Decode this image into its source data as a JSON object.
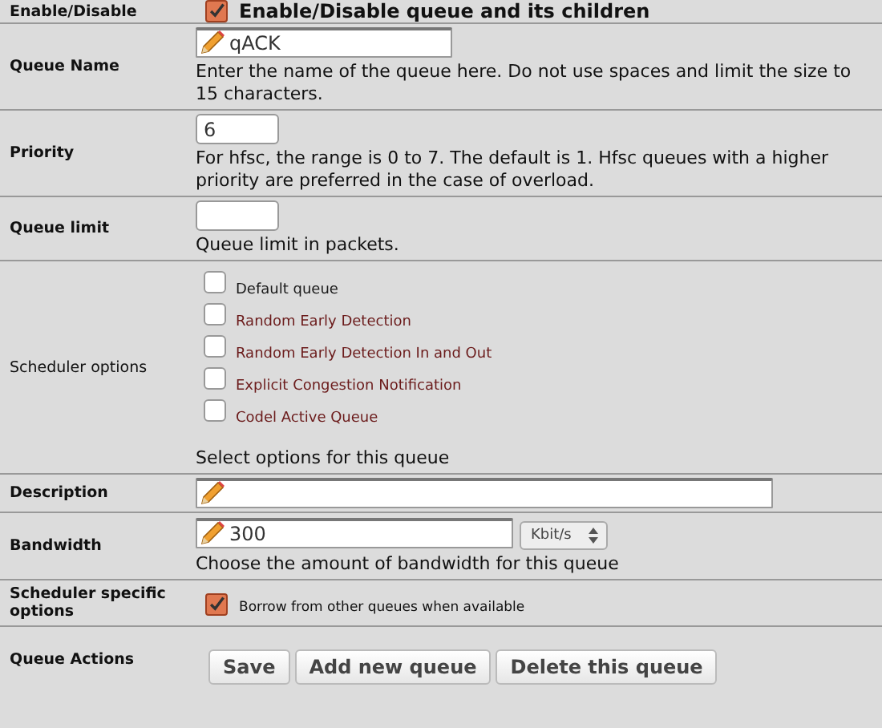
{
  "rows": [
    {
      "kind": "enable",
      "label": "Enable/Disable",
      "label_bold": true,
      "checked": true,
      "text": "Enable/Disable queue and its children"
    },
    {
      "kind": "text",
      "label": "Queue Name",
      "label_bold": true,
      "value": "qACK",
      "wide": false,
      "help": "Enter the name of the queue here. Do not use spaces and limit the size to 15 characters."
    },
    {
      "kind": "small",
      "label": "Priority",
      "label_bold": true,
      "value": "6",
      "help": "For hfsc, the range is 0 to 7. The default is 1. Hfsc queues with a higher priority are preferred in the case of overload."
    },
    {
      "kind": "small",
      "label": "Queue limit",
      "label_bold": true,
      "help": "Queue limit in packets."
    },
    {
      "kind": "options",
      "label": "Scheduler options",
      "label_bold": false,
      "options": [
        {
          "label": "Default queue",
          "checked": false,
          "color": "#1a1a1a"
        },
        {
          "label": "Random Early Detection",
          "checked": false,
          "color": "#6b1b1b"
        },
        {
          "label": "Random Early Detection In and Out",
          "checked": false,
          "color": "#6b1b1b"
        },
        {
          "label": "Explicit Congestion Notification",
          "checked": false,
          "color": "#6b1b1b"
        },
        {
          "label": "Codel Active Queue",
          "checked": false,
          "color": "#6b1b1b"
        }
      ],
      "help": "Select options for this queue"
    },
    {
      "kind": "text",
      "label": "Description",
      "label_bold": true,
      "wide": true
    },
    {
      "kind": "bandwidth",
      "label": "Bandwidth",
      "label_bold": true,
      "value": "300",
      "unit": "Kbit/s",
      "help": "Choose the amount of bandwidth for this queue"
    },
    {
      "kind": "borrow",
      "label": "Scheduler specific options",
      "label_bold": true,
      "checked": true,
      "text": "Borrow from other queues when available"
    },
    {
      "kind": "buttons",
      "label": "Queue Actions",
      "label_bold": true,
      "buttons": [
        "Save",
        "Add new queue",
        "Delete this queue"
      ]
    }
  ]
}
